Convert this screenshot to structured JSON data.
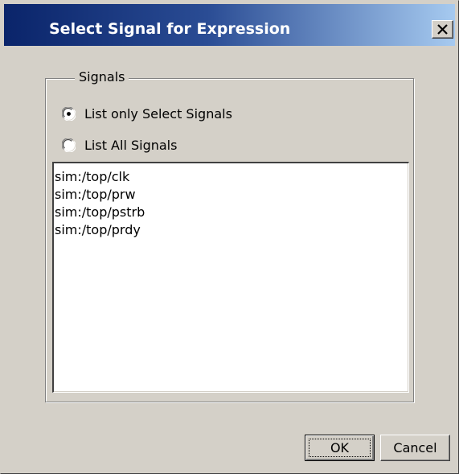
{
  "window": {
    "title": "Select Signal for Expression",
    "close_label": "close"
  },
  "signals_group": {
    "label": "Signals",
    "options": [
      {
        "label": "List only Select Signals",
        "selected": true
      },
      {
        "label": "List All Signals",
        "selected": false
      }
    ],
    "list_items": [
      "sim:/top/clk",
      "sim:/top/prw",
      "sim:/top/pstrb",
      "sim:/top/prdy"
    ]
  },
  "buttons": {
    "ok_label": "OK",
    "cancel_label": "Cancel"
  },
  "icons": {
    "close": "close-icon",
    "radio_selected": "radio-selected-icon",
    "radio_unselected": "radio-unselected-icon"
  },
  "colors": {
    "title_gradient_start": "#0a246a",
    "title_gradient_end": "#a6caf0",
    "face": "#d4d0c8"
  }
}
